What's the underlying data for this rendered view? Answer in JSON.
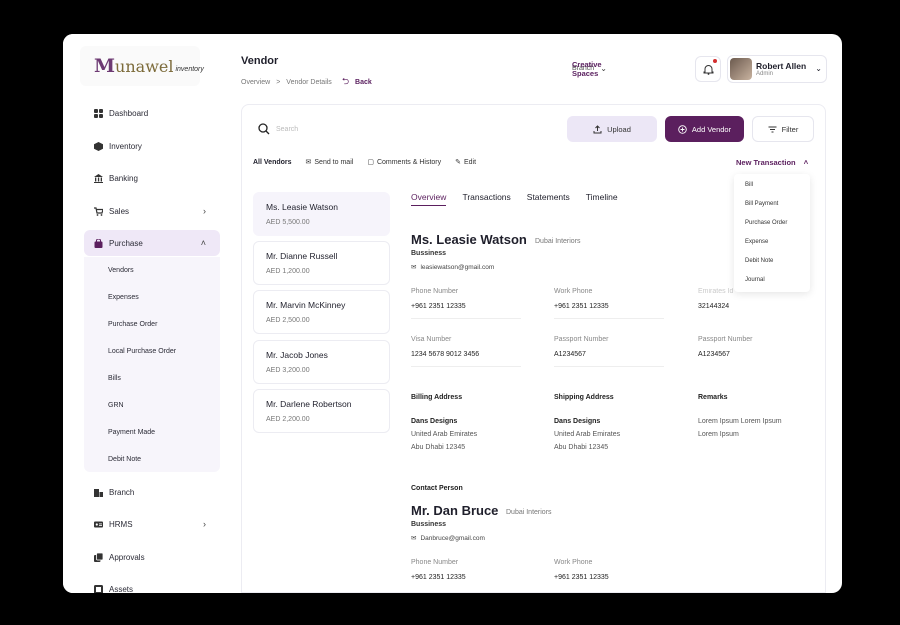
{
  "brand": {
    "logo_m": "M",
    "logo_rest": "unawel",
    "logo_sub": "inventory"
  },
  "sidebar": {
    "items": [
      {
        "label": "Dashboard",
        "icon": "grid-icon"
      },
      {
        "label": "Inventory",
        "icon": "box-icon"
      },
      {
        "label": "Banking",
        "icon": "bank-icon"
      },
      {
        "label": "Sales",
        "icon": "cart-icon"
      },
      {
        "label": "Purchase",
        "icon": "bag-icon"
      },
      {
        "label": "Branch",
        "icon": "building-icon"
      },
      {
        "label": "HRMS",
        "icon": "id-card-icon"
      },
      {
        "label": "Approvals",
        "icon": "approval-icon"
      },
      {
        "label": "Assets",
        "icon": "assets-icon"
      }
    ],
    "purchase_sub": [
      "Vendors",
      "Expenses",
      "Purchase Order",
      "Local Purchase Order",
      "Bills",
      "GRN",
      "Payment Made",
      "Debit Note"
    ]
  },
  "header": {
    "title": "Vendor",
    "crumb1": "Overview",
    "crumb_sep": ">",
    "crumb2": "Vendor Details",
    "back": "Back",
    "branch_label": "Branch",
    "branch_value": "Creative Spaces",
    "user_name": "Robert Allen",
    "user_role": "Admin"
  },
  "toolbar": {
    "search_placeholder": "Search",
    "upload": "Upload",
    "add_vendor": "Add Vendor",
    "filter": "Filter"
  },
  "actions": {
    "all_vendors": "All Vendors",
    "send_mail": "Send to mail",
    "comments": "Comments & History",
    "edit": "Edit",
    "new_transaction": "New Transaction"
  },
  "transaction_menu": [
    "Bill",
    "Bill Payment",
    "Purchase Order",
    "Expense",
    "Debit Note",
    "Journal"
  ],
  "vendors": [
    {
      "name": "Ms. Leasie Watson",
      "amount": "AED 5,500.00"
    },
    {
      "name": "Mr. Dianne Russell",
      "amount": "AED 1,200.00"
    },
    {
      "name": "Mr. Marvin McKinney",
      "amount": "AED 2,500.00"
    },
    {
      "name": "Mr. Jacob Jones",
      "amount": "AED 3,200.00"
    },
    {
      "name": "Mr. Darlene Robertson",
      "amount": "AED 2,200.00"
    }
  ],
  "tabs": [
    "Overview",
    "Transactions",
    "Statements",
    "Timeline"
  ],
  "detail": {
    "name": "Ms. Leasie Watson",
    "company": "Dubai Interiors",
    "type": "Bussiness",
    "email": "leasiewatson@gmail.com",
    "phone_label": "Phone Number",
    "phone": "+961 2351 12335",
    "work_label": "Work Phone",
    "work": "+961 2351 12335",
    "emirates_label": "Emirates Id",
    "emirates": "32144324",
    "visa_label": "Visa Number",
    "visa": "1234 5678 9012 3456",
    "passport_label": "Passport Number",
    "passport": "A1234567",
    "passport2_label": "Passport Number",
    "passport2": "A1234567",
    "billing_label": "Billing Address",
    "billing_name": "Dans Designs",
    "billing_l1": "United Arab Emirates",
    "billing_l2": "Abu Dhabi 12345",
    "shipping_label": "Shipping Address",
    "shipping_name": "Dans Designs",
    "shipping_l1": "United Arab Emirates",
    "shipping_l2": "Abu Dhabi 12345",
    "remarks_label": "Remarks",
    "remarks_l1": "Lorem Ipsum Lorem Ipsum",
    "remarks_l2": "Lorem Ipsum",
    "contact_label": "Contact Person",
    "contact_name": "Mr. Dan Bruce",
    "contact_company": "Dubai Interiors",
    "contact_type": "Bussiness",
    "contact_email": "Danbruce@gmail.com",
    "c_phone_label": "Phone Number",
    "c_phone": "+961 2351 12335",
    "c_work_label": "Work Phone",
    "c_work": "+961 2351 12335"
  },
  "colors": {
    "accent": "#5b1f5e",
    "accent_light": "#ece7f6",
    "notify": "#d32f2f"
  }
}
